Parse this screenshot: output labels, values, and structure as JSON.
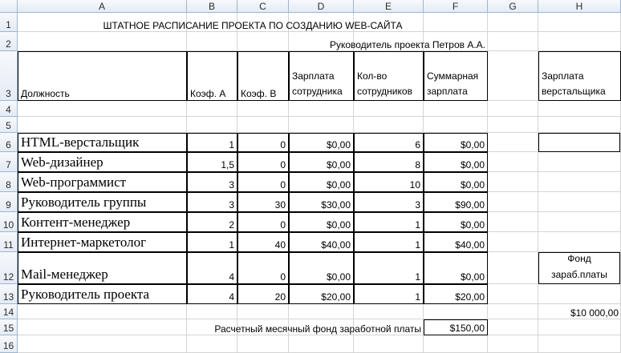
{
  "columns": [
    "A",
    "B",
    "C",
    "D",
    "E",
    "F",
    "G",
    "H"
  ],
  "rows": [
    "1",
    "2",
    "3",
    "4",
    "5",
    "6",
    "7",
    "8",
    "9",
    "10",
    "11",
    "12",
    "13",
    "14",
    "15",
    "16"
  ],
  "title": "ШТАТНОЕ РАСПИСАНИЕ ПРОЕКТА ПО СОЗДАНИЮ WEB-САЙТА",
  "manager_line": "Руководитель проекта Петров А.А.",
  "headers": {
    "position": "Должность",
    "coef_a": "Коэф. А",
    "coef_b": "Коэф. В",
    "salary": "Зарплата сотрудника",
    "count": "Кол-во сотрудников",
    "total": "Суммарная зарплата",
    "h_salary": "Зарплата верстальщика"
  },
  "staff": [
    {
      "position": "HTML-верстальщик",
      "a": "1",
      "b": "0",
      "salary": "$0,00",
      "count": "6",
      "total": "$0,00"
    },
    {
      "position": "Web-дизайнер",
      "a": "1,5",
      "b": "0",
      "salary": "$0,00",
      "count": "8",
      "total": "$0,00"
    },
    {
      "position": "Web-программист",
      "a": "3",
      "b": "0",
      "salary": "$0,00",
      "count": "10",
      "total": "$0,00"
    },
    {
      "position": "Руководитель группы",
      "a": "3",
      "b": "30",
      "salary": "$30,00",
      "count": "3",
      "total": "$90,00"
    },
    {
      "position": "Контент-менеджер",
      "a": "2",
      "b": "0",
      "salary": "$0,00",
      "count": "1",
      "total": "$0,00"
    },
    {
      "position": "Интернет-маркетолог",
      "a": "1",
      "b": "40",
      "salary": "$40,00",
      "count": "1",
      "total": "$40,00"
    },
    {
      "position": "Mail-менеджер",
      "a": "4",
      "b": "0",
      "salary": "$0,00",
      "count": "1",
      "total": "$0,00"
    },
    {
      "position": "Руководитель проекта",
      "a": "4",
      "b": "20",
      "salary": "$20,00",
      "count": "1",
      "total": "$20,00"
    }
  ],
  "fund_label": "Фонд зараб.платы",
  "fund_value": "$10 000,00",
  "monthly_label": "Расчетный месячный фонд заработной платы",
  "monthly_value": "$150,00"
}
